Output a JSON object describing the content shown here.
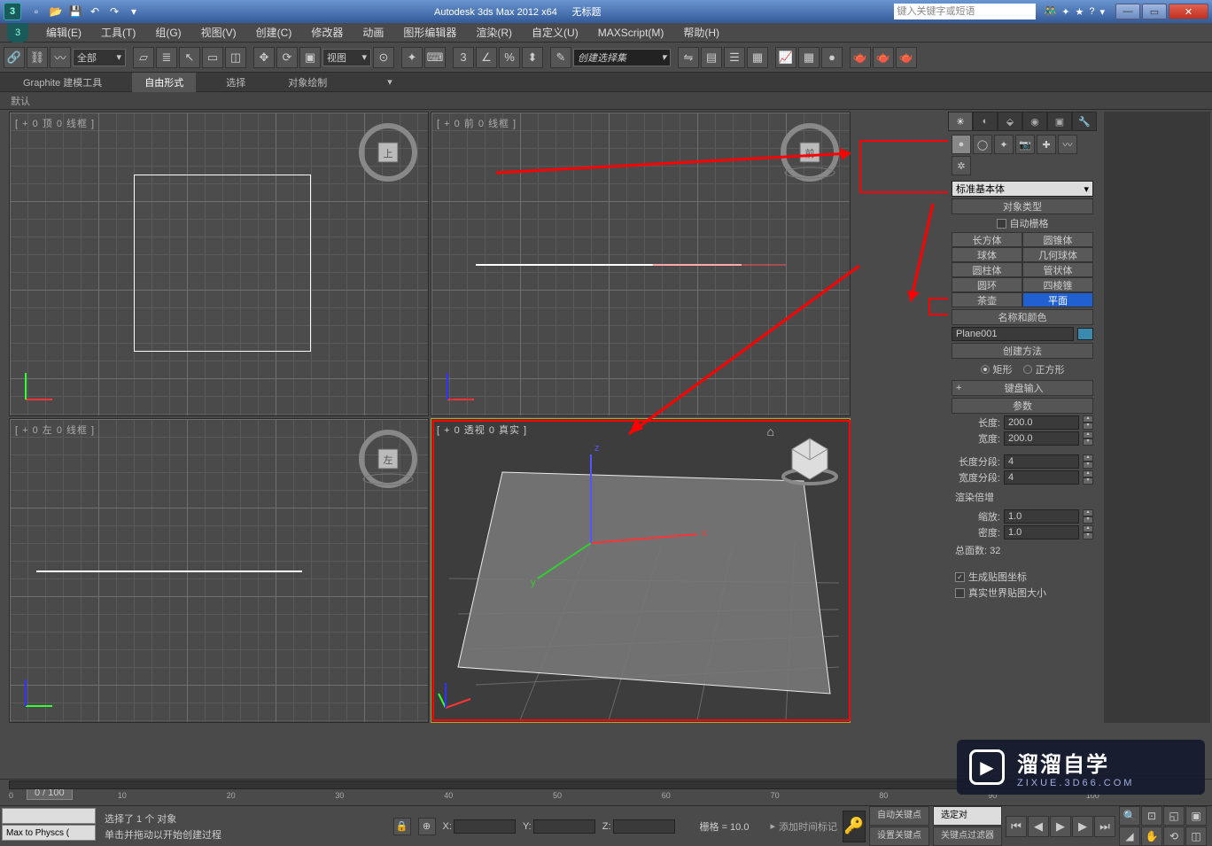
{
  "title_app": "Autodesk 3ds Max  2012 x64",
  "title_doc": "无标题",
  "search_placeholder": "键入关键字或短语",
  "menus": [
    "编辑(E)",
    "工具(T)",
    "组(G)",
    "视图(V)",
    "创建(C)",
    "修改器",
    "动画",
    "图形编辑器",
    "渲染(R)",
    "自定义(U)",
    "MAXScript(M)",
    "帮助(H)"
  ],
  "selection_filter": "全部",
  "view_dropdown": "视图",
  "named_sel_placeholder": "创建选择集",
  "ribbon_tabs": [
    "Graphite 建模工具",
    "自由形式",
    "选择",
    "对象绘制"
  ],
  "ribbon_sub": "默认",
  "viewports": {
    "top": "[ + 0 顶 0 线框 ]",
    "front": "[ + 0 前 0 线框 ]",
    "left": "[ + 0 左 0 线框 ]",
    "persp": "[ + 0 透视 0 真实 ]"
  },
  "panel": {
    "dropdown": "标准基本体",
    "rollout_objtype": "对象类型",
    "autogrid": "自动栅格",
    "types": [
      [
        "长方体",
        "圆锥体"
      ],
      [
        "球体",
        "几何球体"
      ],
      [
        "圆柱体",
        "管状体"
      ],
      [
        "圆环",
        "四棱锥"
      ],
      [
        "茶壶",
        "平面"
      ]
    ],
    "selected_type": "平面",
    "rollout_name": "名称和颜色",
    "obj_name": "Plane001",
    "rollout_method": "创建方法",
    "method_rect": "矩形",
    "method_square": "正方形",
    "rollout_kb": "键盘输入",
    "rollout_params": "参数",
    "length_lbl": "长度:",
    "length_val": "200.0",
    "width_lbl": "宽度:",
    "width_val": "200.0",
    "lseg_lbl": "长度分段:",
    "lseg_val": "4",
    "wseg_lbl": "宽度分段:",
    "wseg_val": "4",
    "render_mult": "渲染倍增",
    "scale_lbl": "缩放:",
    "scale_val": "1.0",
    "density_lbl": "密度:",
    "density_val": "1.0",
    "faces_lbl": "总面数:",
    "faces_val": "32",
    "gen_uv": "生成贴图坐标",
    "real_world": "真实世界贴图大小"
  },
  "timeline": {
    "frame": "0 / 100",
    "ticks": [
      "0",
      "10",
      "20",
      "30",
      "40",
      "50",
      "60",
      "70",
      "80",
      "90",
      "100"
    ]
  },
  "status": {
    "btn1": "",
    "btn2": "Max to Physcs (",
    "sel_info": "选择了 1 个 对象",
    "prompt": "单击并拖动以开始创建过程",
    "x": "X:",
    "y": "Y:",
    "z": "Z:",
    "grid": "栅格 = 10.0",
    "auto_key": "自动关键点",
    "sel_range": "选定对",
    "set_key": "设置关键点",
    "key_filter": "关键点过滤器",
    "add_time_tag": "添加时间标记"
  },
  "watermark": {
    "brand": "溜溜自学",
    "url": "ZIXUE.3D66.COM"
  }
}
